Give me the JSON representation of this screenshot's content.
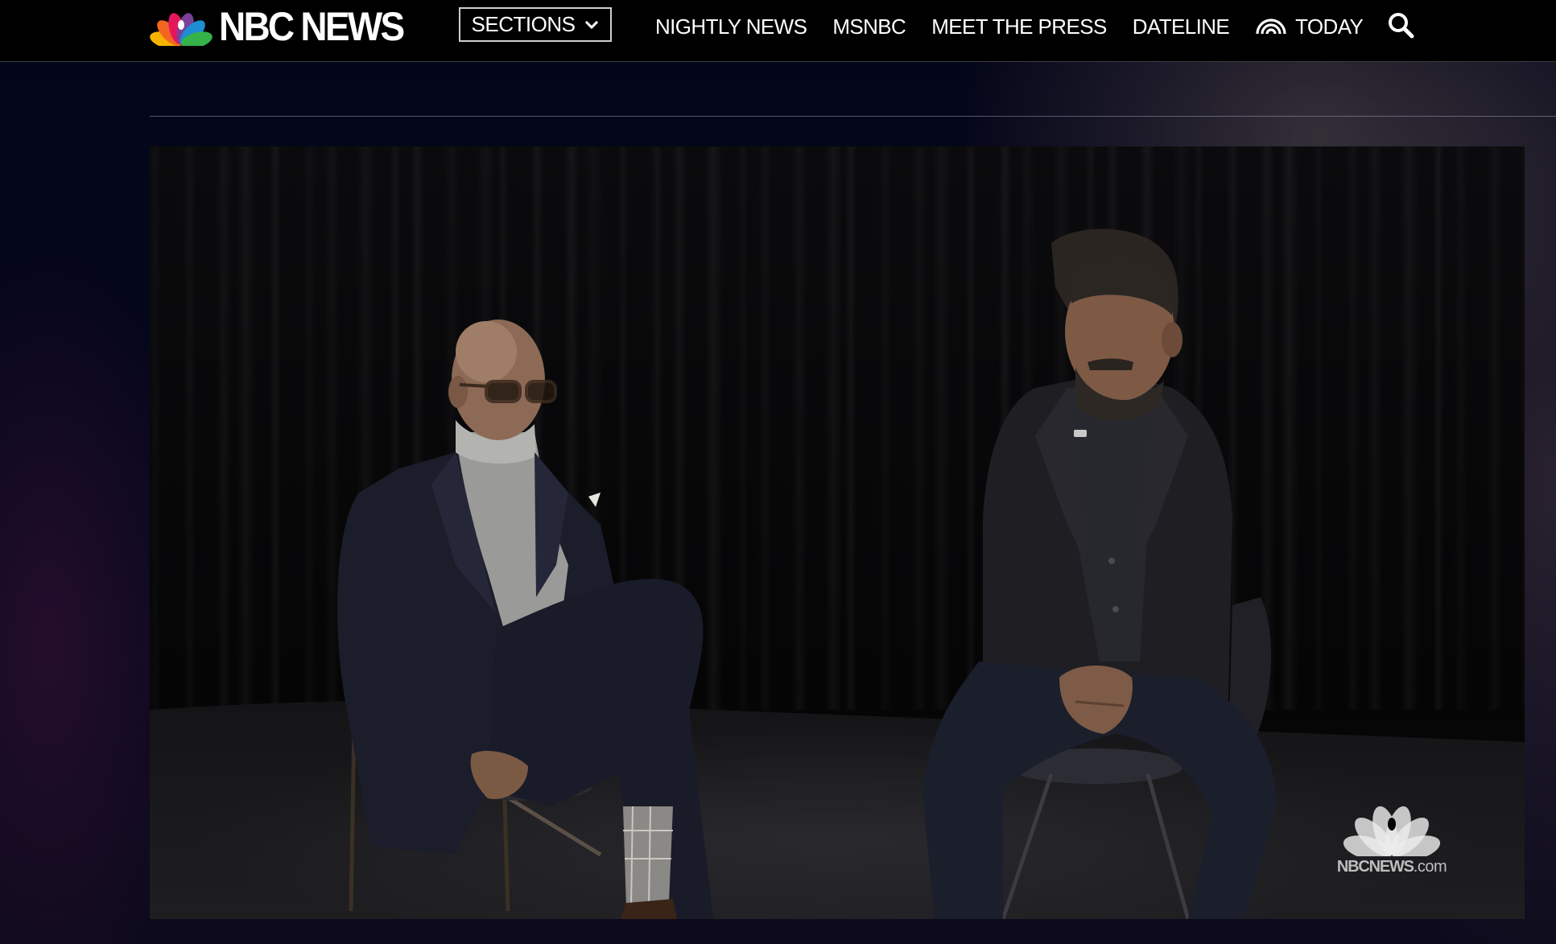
{
  "brand": {
    "name": "NBC NEWS",
    "peacock_colors": [
      "#f5b300",
      "#f26522",
      "#e5175c",
      "#7b3f98",
      "#1d8dd4",
      "#36b24a"
    ]
  },
  "nav": {
    "sections_label": "SECTIONS",
    "links": [
      "NIGHTLY NEWS",
      "MSNBC",
      "MEET THE PRESS",
      "DATELINE",
      "TODAY"
    ],
    "icons": [
      "chevron-down-icon",
      "today-sunrise-icon",
      "search-icon"
    ]
  },
  "video": {
    "watermark": {
      "brand": "NBCNEWS",
      "suffix": ".com"
    }
  },
  "colors": {
    "nav_background": "#000000",
    "nav_text": "#ffffff",
    "page_background": "#04030f"
  }
}
